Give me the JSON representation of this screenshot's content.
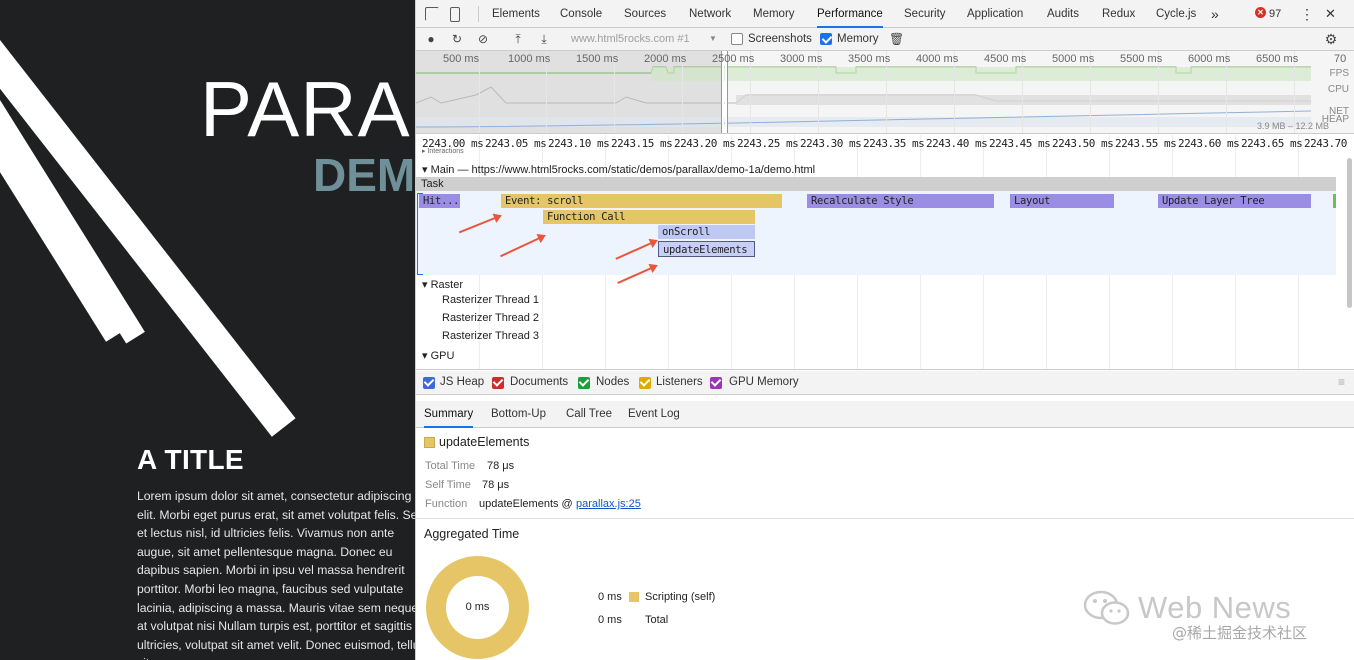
{
  "page": {
    "hero_title": "PARAL",
    "hero_subtitle": "DEM",
    "article_title": "A TITLE",
    "article_body": "Lorem ipsum dolor sit amet, consectetur adipiscing elit. Morbi eget purus erat, sit amet volutpat felis. Sed et lectus nisl, id ultricies felis. Vivamus non ante augue, sit amet pellentesque magna. Donec eu dapibus sapien. Morbi in ipsu vel massa hendrerit porttitor. Morbi leo magna, faucibus sed vulputate lacinia, adipiscing a massa. Mauris vitae sem neque, at volutpat nisi Nullam turpis est, porttitor et sagittis ultricies, volutpat sit amet velit. Donec euismod, tellus sit"
  },
  "devtools": {
    "tabs": [
      "Elements",
      "Console",
      "Sources",
      "Network",
      "Memory",
      "Performance",
      "Security",
      "Application",
      "Audits",
      "Redux",
      "Cycle.js"
    ],
    "more_tabs": "»",
    "error_count": "97",
    "kebab": "⋮",
    "close": "✕",
    "toolbar": {
      "url": "www.html5rocks.com #1",
      "screenshots_label": "Screenshots",
      "memory_label": "Memory"
    },
    "overview": {
      "ticks": [
        "500 ms",
        "1000 ms",
        "1500 ms",
        "2000 ms",
        "2500 ms",
        "3000 ms",
        "3500 ms",
        "4000 ms",
        "4500 ms",
        "5000 ms",
        "5500 ms",
        "6000 ms",
        "6500 ms",
        "70"
      ],
      "fps": "FPS",
      "cpu": "CPU",
      "net": "NET",
      "heap": "HEAP",
      "heap_value": "3.9 MB – 12.2 MB"
    },
    "flame": {
      "ticks": [
        "2243.00 ms",
        "2243.05 ms",
        "2243.10 ms",
        "2243.15 ms",
        "2243.20 ms",
        "2243.25 ms",
        "2243.30 ms",
        "2243.35 ms",
        "2243.40 ms",
        "2243.45 ms",
        "2243.50 ms",
        "2243.55 ms",
        "2243.60 ms",
        "2243.65 ms",
        "2243.70"
      ],
      "interactions": "Interactions",
      "main_track": "Main — https://www.html5rocks.com/static/demos/parallax/demo-1a/demo.html",
      "task": "Task",
      "blocks": {
        "hit_test": "Hit....st",
        "event_scroll": "Event: scroll",
        "function_call": "Function Call",
        "on_scroll": "onScroll",
        "update_elements": "updateElements",
        "recalculate_style": "Recalculate Style",
        "layout": "Layout",
        "update_layer_tree": "Update Layer Tree"
      },
      "raster": "Raster",
      "threads": [
        "Rasterizer Thread 1",
        "Rasterizer Thread 2",
        "Rasterizer Thread 3"
      ],
      "gpu": "GPU"
    },
    "memory_counters": [
      {
        "label": "JS Heap",
        "color": "#3d6bd6"
      },
      {
        "label": "Documents",
        "color": "#c9302c"
      },
      {
        "label": "Nodes",
        "color": "#1e9e3a"
      },
      {
        "label": "Listeners",
        "color": "#e0a800"
      },
      {
        "label": "GPU Memory",
        "color": "#9b36b7"
      }
    ],
    "bottom_tabs": [
      "Summary",
      "Bottom-Up",
      "Call Tree",
      "Event Log"
    ],
    "summary": {
      "title": "updateElements",
      "total_time_label": "Total Time",
      "total_time_value": "78 μs",
      "self_time_label": "Self Time",
      "self_time_value": "78 μs",
      "function_label": "Function",
      "function_name": "updateElements @",
      "function_link": "parallax.js:25",
      "aggregated_title": "Aggregated Time",
      "donut_center": "0 ms",
      "legend": [
        {
          "value": "0 ms",
          "label": "Scripting (self)",
          "swatch": true
        },
        {
          "value": "0 ms",
          "label": "Total",
          "swatch": false
        }
      ]
    }
  },
  "watermark": {
    "text": "Web News",
    "sub": "@稀土掘金技术社区"
  },
  "colors": {
    "scripting": "#e5c566",
    "rendering": "#9b8ce6",
    "task": "#cfcfcf",
    "accent": "#1a73e8",
    "annotation": "#e8573c"
  }
}
